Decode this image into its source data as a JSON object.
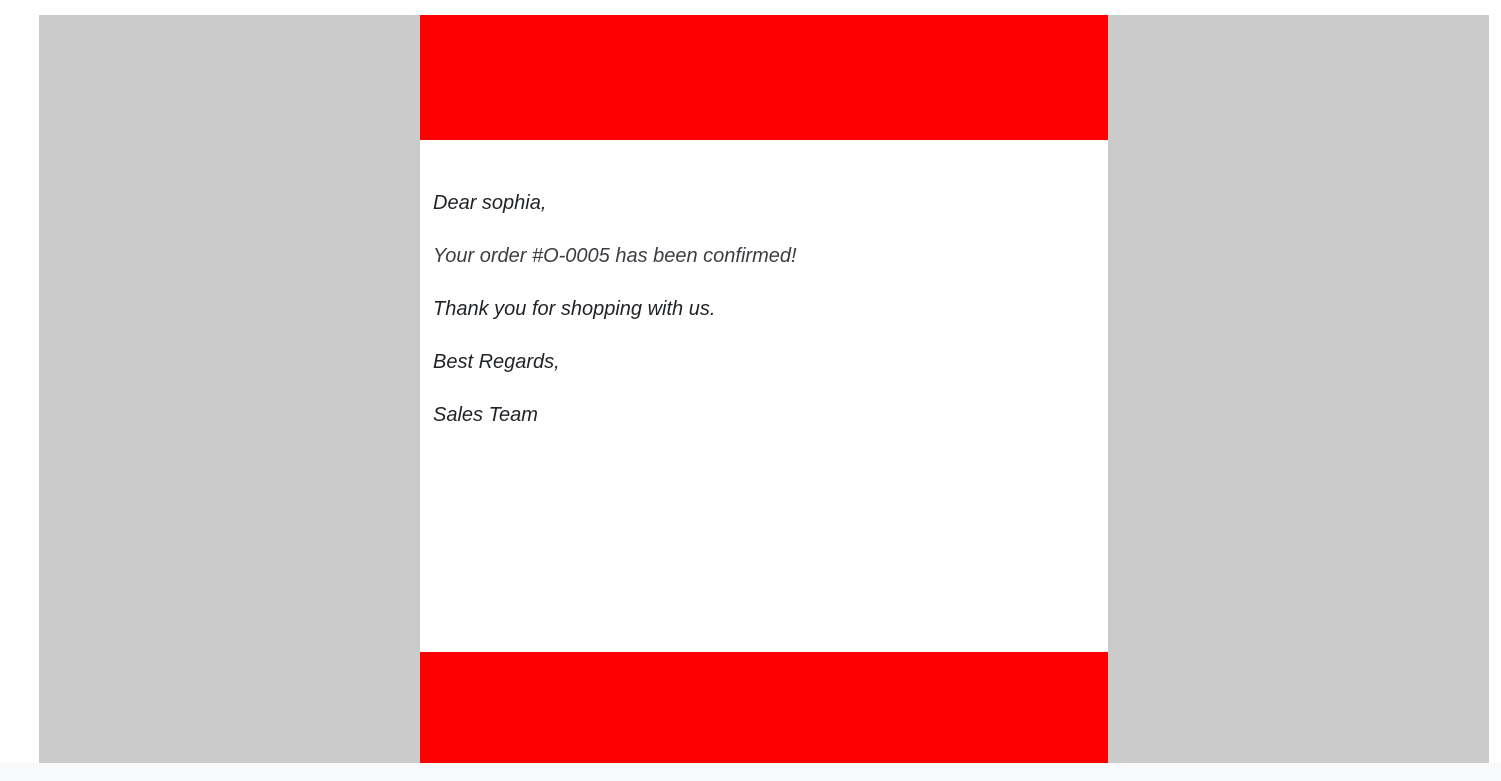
{
  "colors": {
    "page_background": "#ffffff",
    "backdrop": "#cbcbcb",
    "banner": "#ff0000",
    "body_text": "#1f2226"
  },
  "email": {
    "greeting": "Dear sophia,",
    "confirmation": "Your order #O-0005 has been confirmed!",
    "thanks": "Thank you for shopping with us.",
    "closing": "Best Regards,",
    "signature": "Sales Team"
  }
}
